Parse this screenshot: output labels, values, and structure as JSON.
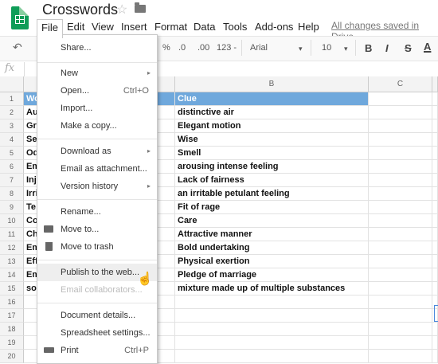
{
  "app": {
    "title": "Crosswords",
    "save_status": "All changes saved in Drive"
  },
  "menubar": [
    "File",
    "Edit",
    "View",
    "Insert",
    "Format",
    "Data",
    "Tools",
    "Add-ons",
    "Help"
  ],
  "toolbar": {
    "percent": "%",
    "dec_less": ".0",
    "dec_more": ".00",
    "more_formats": "123",
    "font": "Arial",
    "font_size": "10",
    "bold": "B",
    "italic": "I",
    "strike": "S",
    "text_color": "A"
  },
  "formula_bar": {
    "fx": "fx"
  },
  "file_menu": {
    "items": [
      {
        "label": "Share..."
      },
      {
        "label": "New",
        "submenu": true
      },
      {
        "label": "Open...",
        "shortcut": "Ctrl+O"
      },
      {
        "label": "Import..."
      },
      {
        "label": "Make a copy..."
      },
      {
        "label": "Download as",
        "submenu": true
      },
      {
        "label": "Email as attachment..."
      },
      {
        "label": "Version history",
        "submenu": true
      },
      {
        "label": "Rename..."
      },
      {
        "label": "Move to..."
      },
      {
        "label": "Move to trash"
      },
      {
        "label": "Publish to the web..."
      },
      {
        "label": "Email collaborators..."
      },
      {
        "label": "Document details..."
      },
      {
        "label": "Spreadsheet settings..."
      },
      {
        "label": "Print",
        "shortcut": "Ctrl+P"
      }
    ],
    "arrow": "▸"
  },
  "sheet": {
    "columns": [
      "B",
      "C"
    ],
    "rows": [
      "1",
      "2",
      "3",
      "4",
      "5",
      "6",
      "7",
      "8",
      "9",
      "10",
      "11",
      "12",
      "13",
      "14",
      "15",
      "16",
      "17",
      "18",
      "19",
      "20"
    ],
    "col_a_visible": [
      "Wo",
      "Au",
      "Gr",
      "Se",
      "Od",
      "Em",
      "Inj",
      "Irri",
      "Te",
      "Co",
      "Ch",
      "Em",
      "Eff",
      "Em",
      "so"
    ],
    "col_b": [
      "Clue",
      "distinctive air",
      "Elegant motion",
      "Wise",
      "Smell",
      "arousing intense feeling",
      "Lack of fairness",
      "an irritable petulant feeling",
      "Fit of rage",
      "Care",
      "Attractive manner",
      "Bold undertaking",
      "Physical exertion",
      "Pledge of marriage",
      "mixture made up of multiple substances"
    ]
  },
  "colors": {
    "header_fill": "#6fa8dc",
    "logo_green": "#0f9d58",
    "selection_blue": "#4a89dc"
  }
}
